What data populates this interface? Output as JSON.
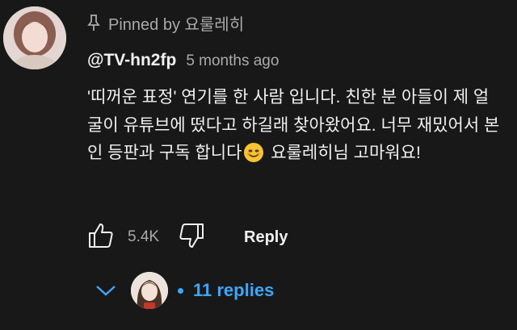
{
  "pinned": {
    "text": "Pinned by 요룰레히",
    "icon": "pin-icon"
  },
  "author": {
    "handle": "@TV-hn2fp",
    "timestamp": "5 months ago"
  },
  "comment": {
    "part1": "'띠꺼운 표정' 연기를 한 사람 입니다. 친한 분 아들이 제 얼굴이 유튜브에 떴다고 하길래 찾아왔어요. 너무 재밌어서 본인 등판과 구독 합니다",
    "emoji": "smiling-face-emoji",
    "part2": " 요룰레히님 고마워요!"
  },
  "actions": {
    "like_count": "5.4K",
    "reply_label": "Reply"
  },
  "replies": {
    "label": "11 replies",
    "accent": "#3ea6ff"
  },
  "colors": {
    "background": "#181818",
    "text": "#f1f1f1",
    "muted": "#aaaaaa"
  }
}
